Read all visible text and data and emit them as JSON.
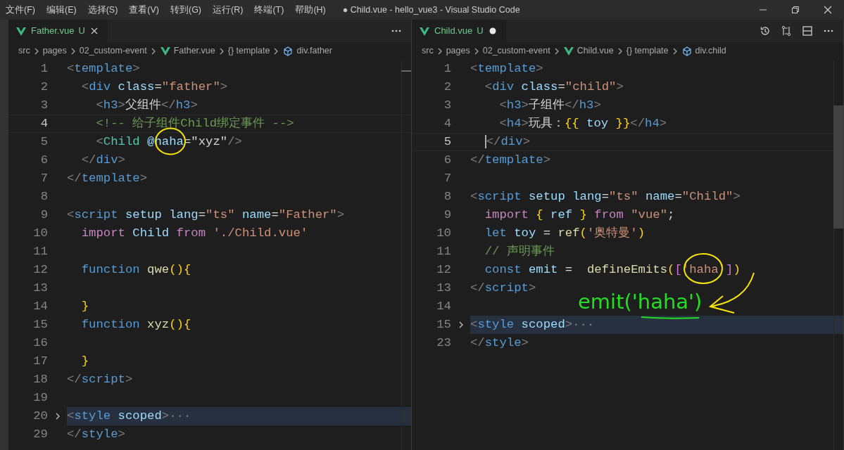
{
  "window": {
    "title": "● Child.vue - hello_vue3 - Visual Studio Code"
  },
  "menu": [
    "文件(F)",
    "编辑(E)",
    "选择(S)",
    "查看(V)",
    "转到(G)",
    "运行(R)",
    "终端(T)",
    "帮助(H)"
  ],
  "editors": [
    {
      "tabs": [
        {
          "label": "Father.vue",
          "status": "U",
          "selected": true,
          "dirty": false
        }
      ],
      "breadcrumb": [
        {
          "text": "src",
          "kind": "path"
        },
        {
          "text": "pages",
          "kind": "path"
        },
        {
          "text": "02_custom-event",
          "kind": "path"
        },
        {
          "text": "Father.vue",
          "kind": "file"
        },
        {
          "text": "{} template",
          "kind": "path"
        },
        {
          "text": "div.father",
          "kind": "element"
        }
      ],
      "lines": [
        {
          "number": "1",
          "current": false,
          "folded": false,
          "tokens": [
            {
              "kind": "punct",
              "text": "<"
            },
            {
              "kind": "tag",
              "text": "template"
            },
            {
              "kind": "punct",
              "text": ">"
            }
          ]
        },
        {
          "number": "2",
          "current": false,
          "folded": false,
          "tokens": [
            {
              "kind": "punct",
              "text": "  <"
            },
            {
              "kind": "tag",
              "text": "div"
            },
            {
              "kind": "attr",
              "text": " class"
            },
            {
              "kind": "text",
              "text": "="
            },
            {
              "kind": "str",
              "text": "\"father\""
            },
            {
              "kind": "punct",
              "text": ">"
            }
          ]
        },
        {
          "number": "3",
          "current": false,
          "folded": false,
          "tokens": [
            {
              "kind": "punct",
              "text": "    <"
            },
            {
              "kind": "tag",
              "text": "h3"
            },
            {
              "kind": "punct",
              "text": ">"
            },
            {
              "kind": "text",
              "text": "父组件"
            },
            {
              "kind": "punct",
              "text": "</"
            },
            {
              "kind": "tag",
              "text": "h3"
            },
            {
              "kind": "punct",
              "text": ">"
            }
          ]
        },
        {
          "number": "4",
          "current": true,
          "folded": false,
          "tokens": [
            {
              "kind": "comment",
              "text": "    <!-- 给子组件Child绑定事件 -->"
            }
          ]
        },
        {
          "number": "5",
          "current": false,
          "folded": false,
          "tokens": [
            {
              "kind": "punct",
              "text": "    <"
            },
            {
              "kind": "component",
              "text": "Child"
            },
            {
              "kind": "attr",
              "text": " @haha"
            },
            {
              "kind": "text",
              "text": "=\"xyz\""
            },
            {
              "kind": "punct",
              "text": "/>"
            }
          ]
        },
        {
          "number": "6",
          "current": false,
          "folded": false,
          "tokens": [
            {
              "kind": "punct",
              "text": "  </"
            },
            {
              "kind": "tag",
              "text": "div"
            },
            {
              "kind": "punct",
              "text": ">"
            }
          ]
        },
        {
          "number": "7",
          "current": false,
          "folded": false,
          "tokens": [
            {
              "kind": "punct",
              "text": "</"
            },
            {
              "kind": "tag",
              "text": "template"
            },
            {
              "kind": "punct",
              "text": ">"
            }
          ]
        },
        {
          "number": "8",
          "current": false,
          "folded": false
        },
        {
          "number": "9",
          "current": false,
          "folded": false,
          "tokens": [
            {
              "kind": "punct",
              "text": "<"
            },
            {
              "kind": "tag",
              "text": "script"
            },
            {
              "kind": "attr",
              "text": " setup lang"
            },
            {
              "kind": "text",
              "text": "="
            },
            {
              "kind": "str",
              "text": "\"ts\""
            },
            {
              "kind": "attr",
              "text": " name"
            },
            {
              "kind": "text",
              "text": "="
            },
            {
              "kind": "str",
              "text": "\"Father\""
            },
            {
              "kind": "punct",
              "text": ">"
            }
          ]
        },
        {
          "number": "10",
          "current": false,
          "folded": false,
          "tokens": [
            {
              "kind": "keyword",
              "text": "  import"
            },
            {
              "kind": "ident",
              "text": " Child"
            },
            {
              "kind": "keyword",
              "text": " from"
            },
            {
              "kind": "str",
              "text": " './Child.vue'"
            }
          ]
        },
        {
          "number": "11",
          "current": false,
          "folded": false
        },
        {
          "number": "12",
          "current": false,
          "folded": false,
          "tokens": [
            {
              "kind": "storage",
              "text": "  function"
            },
            {
              "kind": "func",
              "text": " qwe"
            },
            {
              "kind": "bracket",
              "text": "(){"
            }
          ]
        },
        {
          "number": "13",
          "current": false,
          "folded": false
        },
        {
          "number": "14",
          "current": false,
          "folded": false,
          "tokens": [
            {
              "kind": "bracket",
              "text": "  }"
            }
          ]
        },
        {
          "number": "15",
          "current": false,
          "folded": false,
          "tokens": [
            {
              "kind": "storage",
              "text": "  function"
            },
            {
              "kind": "func",
              "text": " xyz"
            },
            {
              "kind": "bracket",
              "text": "(){"
            }
          ]
        },
        {
          "number": "16",
          "current": false,
          "folded": false
        },
        {
          "number": "17",
          "current": false,
          "folded": false,
          "tokens": [
            {
              "kind": "bracket",
              "text": "  }"
            }
          ]
        },
        {
          "number": "18",
          "current": false,
          "folded": false,
          "tokens": [
            {
              "kind": "punct",
              "text": "</"
            },
            {
              "kind": "tag",
              "text": "script"
            },
            {
              "kind": "punct",
              "text": ">"
            }
          ]
        },
        {
          "number": "19",
          "current": false,
          "folded": false
        },
        {
          "number": "20",
          "current": false,
          "folded": true,
          "tokens": [
            {
              "kind": "punct",
              "text": "<"
            },
            {
              "kind": "tag",
              "text": "style"
            },
            {
              "kind": "attr",
              "text": " scoped"
            },
            {
              "kind": "punct",
              "text": ">···"
            }
          ]
        },
        {
          "number": "29",
          "current": false,
          "folded": false,
          "tokens": [
            {
              "kind": "punct",
              "text": "</"
            },
            {
              "kind": "tag",
              "text": "style"
            },
            {
              "kind": "punct",
              "text": ">"
            }
          ]
        }
      ]
    },
    {
      "tabs": [
        {
          "label": "Child.vue",
          "status": "U",
          "selected": true,
          "dirty": true
        }
      ],
      "breadcrumb": [
        {
          "text": "src",
          "kind": "path"
        },
        {
          "text": "pages",
          "kind": "path"
        },
        {
          "text": "02_custom-event",
          "kind": "path"
        },
        {
          "text": "Child.vue",
          "kind": "file"
        },
        {
          "text": "{} template",
          "kind": "path"
        },
        {
          "text": "div.child",
          "kind": "element"
        }
      ],
      "lines": [
        {
          "number": "1",
          "current": false,
          "folded": false,
          "tokens": [
            {
              "kind": "punct",
              "text": "<"
            },
            {
              "kind": "tag",
              "text": "template"
            },
            {
              "kind": "punct",
              "text": ">"
            }
          ]
        },
        {
          "number": "2",
          "current": false,
          "folded": false,
          "tokens": [
            {
              "kind": "punct",
              "text": "  <"
            },
            {
              "kind": "tag",
              "text": "div"
            },
            {
              "kind": "attr",
              "text": " class"
            },
            {
              "kind": "text",
              "text": "="
            },
            {
              "kind": "str",
              "text": "\"child\""
            },
            {
              "kind": "punct",
              "text": ">"
            }
          ]
        },
        {
          "number": "3",
          "current": false,
          "folded": false,
          "tokens": [
            {
              "kind": "punct",
              "text": "    <"
            },
            {
              "kind": "tag",
              "text": "h3"
            },
            {
              "kind": "punct",
              "text": ">"
            },
            {
              "kind": "text",
              "text": "子组件"
            },
            {
              "kind": "punct",
              "text": "</"
            },
            {
              "kind": "tag",
              "text": "h3"
            },
            {
              "kind": "punct",
              "text": ">"
            }
          ]
        },
        {
          "number": "4",
          "current": false,
          "folded": false,
          "tokens": [
            {
              "kind": "punct",
              "text": "    <"
            },
            {
              "kind": "tag",
              "text": "h4"
            },
            {
              "kind": "punct",
              "text": ">"
            },
            {
              "kind": "text",
              "text": "玩具："
            },
            {
              "kind": "bracket",
              "text": "{{"
            },
            {
              "kind": "ident",
              "text": " toy "
            },
            {
              "kind": "bracket",
              "text": "}}"
            },
            {
              "kind": "punct",
              "text": "</"
            },
            {
              "kind": "tag",
              "text": "h4"
            },
            {
              "kind": "punct",
              "text": ">"
            }
          ]
        },
        {
          "number": "5",
          "current": true,
          "folded": false,
          "tokens": [
            {
              "kind": "punct",
              "text": "  </"
            },
            {
              "kind": "tag",
              "text": "div"
            },
            {
              "kind": "punct",
              "text": ">"
            }
          ]
        },
        {
          "number": "6",
          "current": false,
          "folded": false,
          "tokens": [
            {
              "kind": "punct",
              "text": "</"
            },
            {
              "kind": "tag",
              "text": "template"
            },
            {
              "kind": "punct",
              "text": ">"
            }
          ]
        },
        {
          "number": "7",
          "current": false,
          "folded": false
        },
        {
          "number": "8",
          "current": false,
          "folded": false,
          "tokens": [
            {
              "kind": "punct",
              "text": "<"
            },
            {
              "kind": "tag",
              "text": "script"
            },
            {
              "kind": "attr",
              "text": " setup lang"
            },
            {
              "kind": "text",
              "text": "="
            },
            {
              "kind": "str",
              "text": "\"ts\""
            },
            {
              "kind": "attr",
              "text": " name"
            },
            {
              "kind": "text",
              "text": "="
            },
            {
              "kind": "str",
              "text": "\"Child\""
            },
            {
              "kind": "punct",
              "text": ">"
            }
          ]
        },
        {
          "number": "9",
          "current": false,
          "folded": false,
          "tokens": [
            {
              "kind": "keyword",
              "text": "  import"
            },
            {
              "kind": "bracket",
              "text": " {"
            },
            {
              "kind": "ident",
              "text": " ref"
            },
            {
              "kind": "bracket",
              "text": " }"
            },
            {
              "kind": "keyword",
              "text": " from"
            },
            {
              "kind": "str",
              "text": " \"vue\""
            },
            {
              "kind": "text",
              "text": ";"
            }
          ]
        },
        {
          "number": "10",
          "current": false,
          "folded": false,
          "tokens": [
            {
              "kind": "storage",
              "text": "  let"
            },
            {
              "kind": "ident",
              "text": " toy"
            },
            {
              "kind": "text",
              "text": " = "
            },
            {
              "kind": "func",
              "text": "ref"
            },
            {
              "kind": "bracket",
              "text": "("
            },
            {
              "kind": "str",
              "text": "'奥特曼'"
            },
            {
              "kind": "bracket",
              "text": ")"
            }
          ]
        },
        {
          "number": "11",
          "current": false,
          "folded": false,
          "tokens": [
            {
              "kind": "comment",
              "text": "  // 声明事件"
            }
          ]
        },
        {
          "number": "12",
          "current": false,
          "folded": false,
          "tokens": [
            {
              "kind": "storage",
              "text": "  const"
            },
            {
              "kind": "ident",
              "text": " emit"
            },
            {
              "kind": "text",
              "text": " =  "
            },
            {
              "kind": "func",
              "text": "defineEmits"
            },
            {
              "kind": "bracket",
              "text": "("
            },
            {
              "kind": "bracket2",
              "text": "["
            },
            {
              "kind": "str",
              "text": "'haha'"
            },
            {
              "kind": "bracket2",
              "text": "]"
            },
            {
              "kind": "bracket",
              "text": ")"
            }
          ]
        },
        {
          "number": "13",
          "current": false,
          "folded": false,
          "tokens": [
            {
              "kind": "punct",
              "text": "</"
            },
            {
              "kind": "tag",
              "text": "script"
            },
            {
              "kind": "punct",
              "text": ">"
            }
          ]
        },
        {
          "number": "14",
          "current": false,
          "folded": false
        },
        {
          "number": "15",
          "current": false,
          "folded": true,
          "tokens": [
            {
              "kind": "punct",
              "text": "<"
            },
            {
              "kind": "tag",
              "text": "style"
            },
            {
              "kind": "attr",
              "text": " scoped"
            },
            {
              "kind": "punct",
              "text": ">···"
            }
          ]
        },
        {
          "number": "23",
          "current": false,
          "folded": false,
          "tokens": [
            {
              "kind": "punct",
              "text": "</"
            },
            {
              "kind": "tag",
              "text": "style"
            },
            {
              "kind": "punct",
              "text": ">"
            }
          ]
        }
      ],
      "annotation": {
        "text": "emit('haha')"
      }
    }
  ]
}
